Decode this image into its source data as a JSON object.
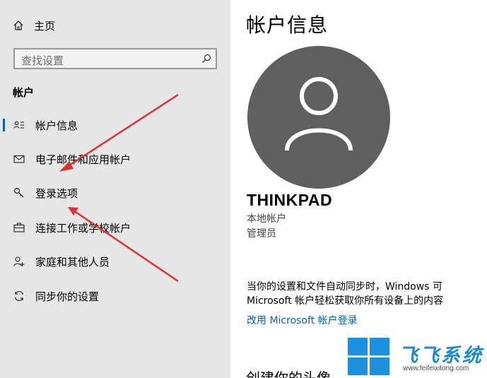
{
  "sidebar": {
    "home_label": "主页",
    "search_placeholder": "查找设置",
    "section_title": "帐户",
    "items": [
      {
        "label": "帐户信息",
        "icon": "person-card-icon",
        "active": true
      },
      {
        "label": "电子邮件和应用帐户",
        "icon": "mail-icon"
      },
      {
        "label": "登录选项",
        "icon": "key-icon"
      },
      {
        "label": "连接工作或学校帐户",
        "icon": "briefcase-icon"
      },
      {
        "label": "家庭和其他人员",
        "icon": "person-add-icon"
      },
      {
        "label": "同步你的设置",
        "icon": "sync-icon"
      }
    ]
  },
  "main": {
    "title": "帐户信息",
    "username": "THINKPAD",
    "account_type": "本地帐户",
    "account_role": "管理员",
    "description_line1": "当你的设置和文件自动同步时，Windows 可",
    "description_line2": "Microsoft 帐户轻松获取你所有设备上的内容",
    "link": "改用 Microsoft 帐户登录",
    "next_section_partial": "创建你的头像"
  },
  "watermark": {
    "brand": "飞飞系统",
    "site": "www.feifeixitong.com"
  },
  "colors": {
    "sidebar_bg": "#e6e6e6",
    "accent": "#0063b1",
    "avatar_bg": "#5f5f5f",
    "arrow": "#e03030",
    "watermark_blue": "#1e90e0"
  }
}
